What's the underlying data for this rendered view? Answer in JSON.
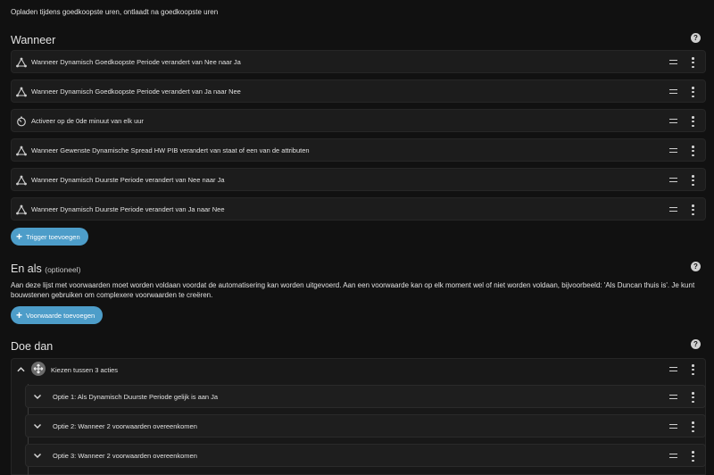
{
  "description": "Opladen tijdens goedkoopste uren, ontlaadt na goedkoopste uren",
  "wanneer": {
    "title": "Wanneer",
    "triggers": [
      {
        "label": "Wanneer Dynamisch Goedkoopste Periode verandert van Nee naar Ja",
        "icon": "state-change-icon"
      },
      {
        "label": "Wanneer Dynamisch Goedkoopste Periode verandert van Ja naar Nee",
        "icon": "state-change-icon"
      },
      {
        "label": "Activeer op de 0de minuut van elk uur",
        "icon": "timer-icon"
      },
      {
        "label": "Wanneer Gewenste Dynamische Spread HW PIB verandert van staat of een van de attributen",
        "icon": "state-change-icon"
      },
      {
        "label": "Wanneer Dynamisch Duurste Periode verandert van Nee naar Ja",
        "icon": "state-change-icon"
      },
      {
        "label": "Wanneer Dynamisch Duurste Periode verandert van Ja naar Nee",
        "icon": "state-change-icon"
      }
    ],
    "add_button": "Trigger toevoegen"
  },
  "en_als": {
    "title": "En als",
    "optional": "(optioneel)",
    "description": "Aan deze lijst met voorwaarden moet worden voldaan voordat de automatisering kan worden uitgevoerd. Aan een voorwaarde kan op elk moment wel of niet worden voldaan, bijvoorbeeld: 'Als Duncan thuis is'. Je kunt bouwstenen gebruiken om complexere voorwaarden te creëren.",
    "add_button": "Voorwaarde toevoegen"
  },
  "doe_dan": {
    "title": "Doe dan",
    "choose_label": "Kiezen tussen 3 acties",
    "options": [
      {
        "label": "Optie 1: Als Dynamisch Duurste Periode gelijk is aan Ja"
      },
      {
        "label": "Optie 2: Wanneer 2 voorwaarden overeenkomen"
      },
      {
        "label": "Optie 3: Wanneer 2 voorwaarden overeenkomen"
      }
    ]
  },
  "help_glyph": "?",
  "colors": {
    "background": "#111111",
    "card": "#1c1c1c",
    "accent": "#4d9dc9"
  }
}
